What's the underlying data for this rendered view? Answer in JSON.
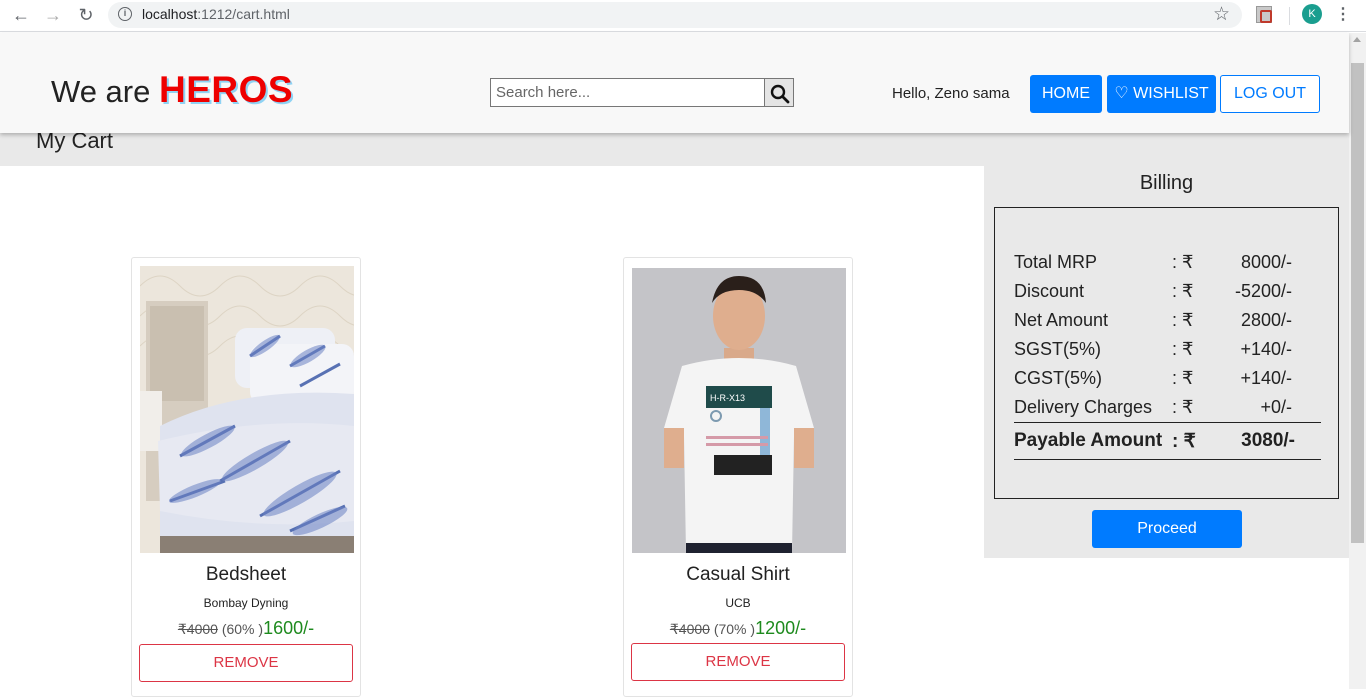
{
  "browser": {
    "url_host": "localhost",
    "url_rest": ":1212/cart.html",
    "avatar_letter": "K"
  },
  "header": {
    "brand_prefix": "We are ",
    "brand_highlight": "HEROS",
    "search_placeholder": "Search here...",
    "greeting": "Hello, Zeno sama",
    "home_label": "HOME",
    "wishlist_label": "♡ WISHLIST",
    "logout_label": "LOG OUT"
  },
  "cart": {
    "title": "My Cart",
    "items": [
      {
        "name": "Bedsheet",
        "brand": "Bombay Dyning",
        "mrp": "₹4000",
        "discount": " (60% )",
        "net": "1600/-",
        "remove_label": "REMOVE"
      },
      {
        "name": "Casual Shirt",
        "brand": "UCB",
        "mrp": "₹4000",
        "discount": " (70% )",
        "net": "1200/-",
        "remove_label": "REMOVE"
      }
    ]
  },
  "billing": {
    "title": "Billing",
    "rows": [
      {
        "label": "Total MRP",
        "sep": ": ₹",
        "value": "8000/-"
      },
      {
        "label": "Discount",
        "sep": ": ₹",
        "value": "-5200/-"
      },
      {
        "label": "Net Amount",
        "sep": ": ₹",
        "value": "2800/-"
      },
      {
        "label": "SGST(5%)",
        "sep": ": ₹",
        "value": "+140/-"
      },
      {
        "label": "CGST(5%)",
        "sep": ": ₹",
        "value": "+140/-"
      },
      {
        "label": "Delivery Charges",
        "sep": ": ₹",
        "value": "+0/-"
      }
    ],
    "total": {
      "label": "Payable Amount",
      "sep": ": ₹",
      "value": "3080/-"
    },
    "proceed_label": "Proceed"
  },
  "colors": {
    "primary": "#007bff",
    "danger": "#dc3545",
    "price_green": "#1e8a1e",
    "brand_red": "#e00"
  }
}
